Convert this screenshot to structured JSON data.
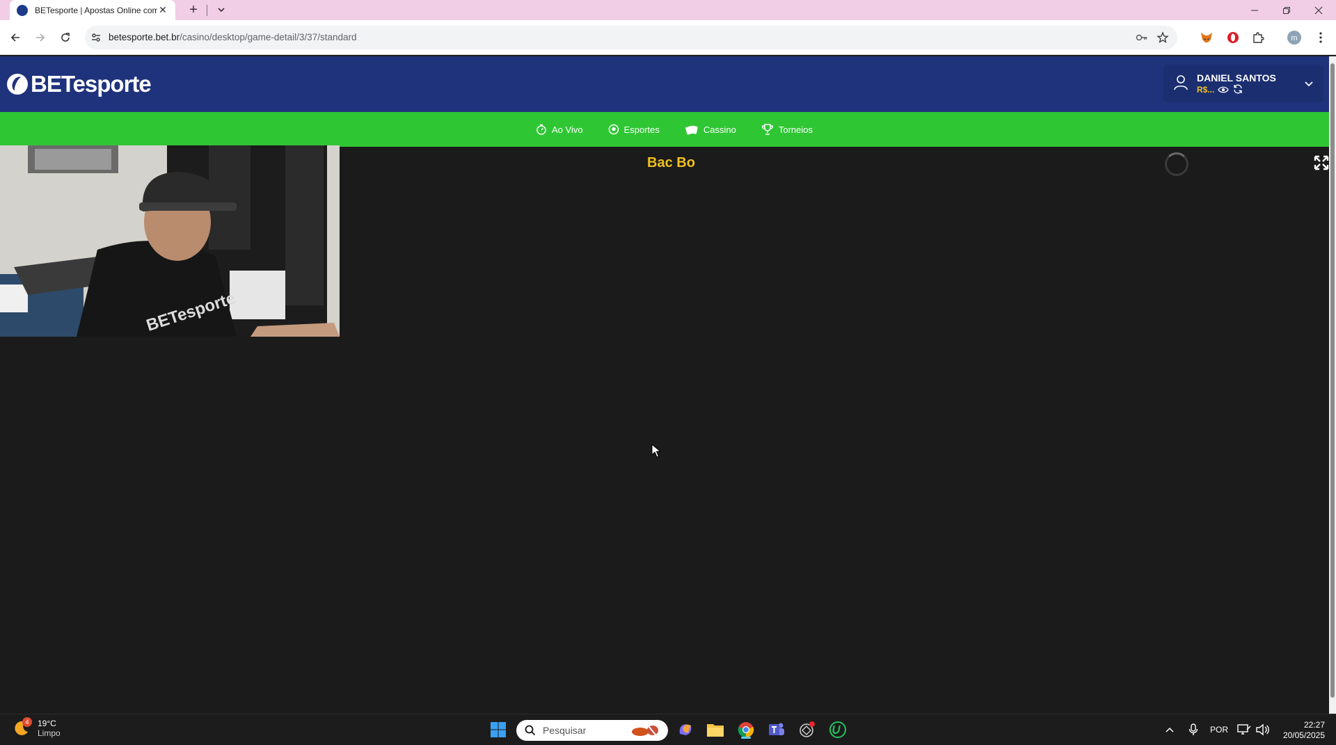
{
  "browser": {
    "tab_title": "BETesporte | Apostas Online com",
    "url_host": "betesporte.bet.br",
    "url_path": "/casino/desktop/game-detail/3/37/standard"
  },
  "site": {
    "logo_text": "BETesporte",
    "user": {
      "name": "DANIEL SANTOS",
      "balance": "R$..."
    },
    "nav": [
      {
        "label": "Ao Vivo",
        "icon": "stopwatch-icon"
      },
      {
        "label": "Esportes",
        "icon": "soccer-ball-icon"
      },
      {
        "label": "Cassino",
        "icon": "cards-icon"
      },
      {
        "label": "Torneios",
        "icon": "trophy-icon"
      }
    ]
  },
  "game": {
    "title": "Bac Bo"
  },
  "taskbar": {
    "weather": {
      "badge": "4",
      "temp": "19°C",
      "condition": "Limpo"
    },
    "search_placeholder": "Pesquisar",
    "language": "POR",
    "time": "22:27",
    "date": "20/05/2025"
  },
  "colors": {
    "header_bg": "#1f337c",
    "nav_bg": "#2fc634",
    "accent": "#f2c01e",
    "tab_strip": "#f1cde6",
    "game_bg": "#1b1b1b"
  }
}
